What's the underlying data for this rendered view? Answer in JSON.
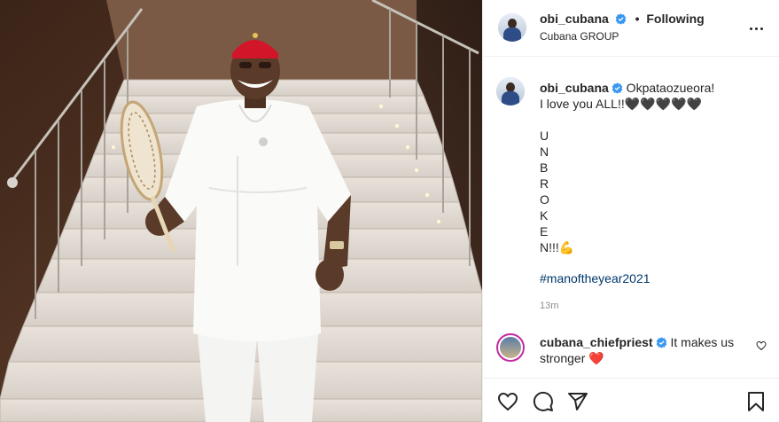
{
  "post": {
    "author": {
      "username": "obi_cubana",
      "follow_status": "Following",
      "separator": "•",
      "subtitle": "Cubana GROUP"
    },
    "caption": {
      "username": "obi_cubana",
      "line1": " Okpataozueora!",
      "line2": "I love you ALL!!",
      "hearts": "🖤🖤🖤🖤🖤",
      "body": "\nU\nN\nB\nR\nO\nK\nE\nN!!!💪",
      "hashtag": "#manoftheyear2021"
    },
    "timestamp": "13m",
    "comment": {
      "username": "cubana_chiefpriest",
      "text": " It makes us stronger ",
      "emoji": "❤️"
    },
    "icons": {
      "verified": "verified-badge-icon",
      "more": "more-options-icon",
      "like": "heart-icon",
      "comment": "comment-icon",
      "share": "share-icon",
      "save": "bookmark-icon"
    },
    "colors": {
      "verified": "#3897f0",
      "hashtag": "#00376b",
      "timestamp": "#8e8e8e",
      "red_heart": "#ed4956"
    }
  }
}
